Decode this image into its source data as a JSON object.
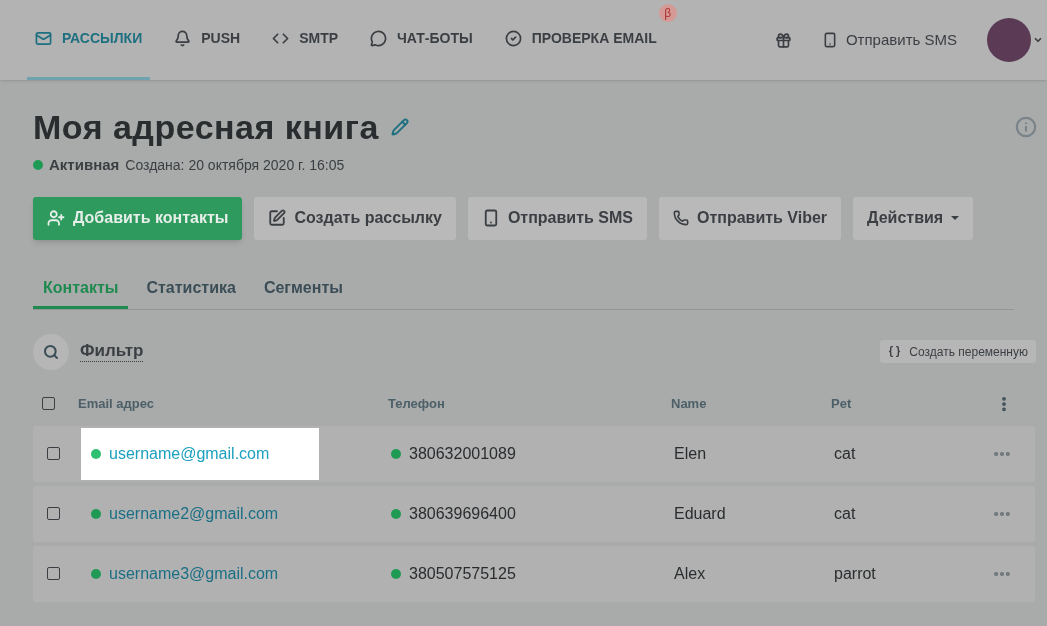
{
  "nav": {
    "items": [
      {
        "label": "РАССЫЛКИ",
        "selected": true
      },
      {
        "label": "PUSH",
        "selected": false
      },
      {
        "label": "SMTP",
        "selected": false
      },
      {
        "label": "ЧАТ-БОТЫ",
        "selected": false
      },
      {
        "label": "ПРОВЕРКА EMAIL",
        "selected": false,
        "badge": "β"
      }
    ],
    "sms_link": "Отправить SMS"
  },
  "title": "Моя адресная книга",
  "status": {
    "label": "Активная",
    "created": "Создана: 20 октября 2020 г. 16:05",
    "color": "#1f9a55"
  },
  "actions": [
    {
      "label": "Добавить контакты",
      "kind": "primary"
    },
    {
      "label": "Создать рассылку",
      "kind": "default"
    },
    {
      "label": "Отправить SMS",
      "kind": "default"
    },
    {
      "label": "Отправить Viber",
      "kind": "default"
    },
    {
      "label": "Действия",
      "kind": "dropdown"
    }
  ],
  "tabs": [
    {
      "label": "Контакты",
      "selected": true
    },
    {
      "label": "Статистика",
      "selected": false
    },
    {
      "label": "Сегменты",
      "selected": false
    }
  ],
  "filter": {
    "label": "Фильтр",
    "variable_button": "Создать переменную"
  },
  "table": {
    "header_checked": false,
    "columns": [
      "Email адрес",
      "Телефон",
      "Name",
      "Pet"
    ],
    "rows": [
      {
        "checked": false,
        "email": "username@gmail.com",
        "highlighted": true,
        "phone": "380632001089",
        "name": "Elen",
        "pet": "cat"
      },
      {
        "checked": false,
        "email": "username2@gmail.com",
        "highlighted": false,
        "phone": "380639696400",
        "name": "Eduard",
        "pet": "cat"
      },
      {
        "checked": false,
        "email": "username3@gmail.com",
        "highlighted": false,
        "phone": "380507575125",
        "name": "Alex",
        "pet": "parrot"
      }
    ]
  }
}
